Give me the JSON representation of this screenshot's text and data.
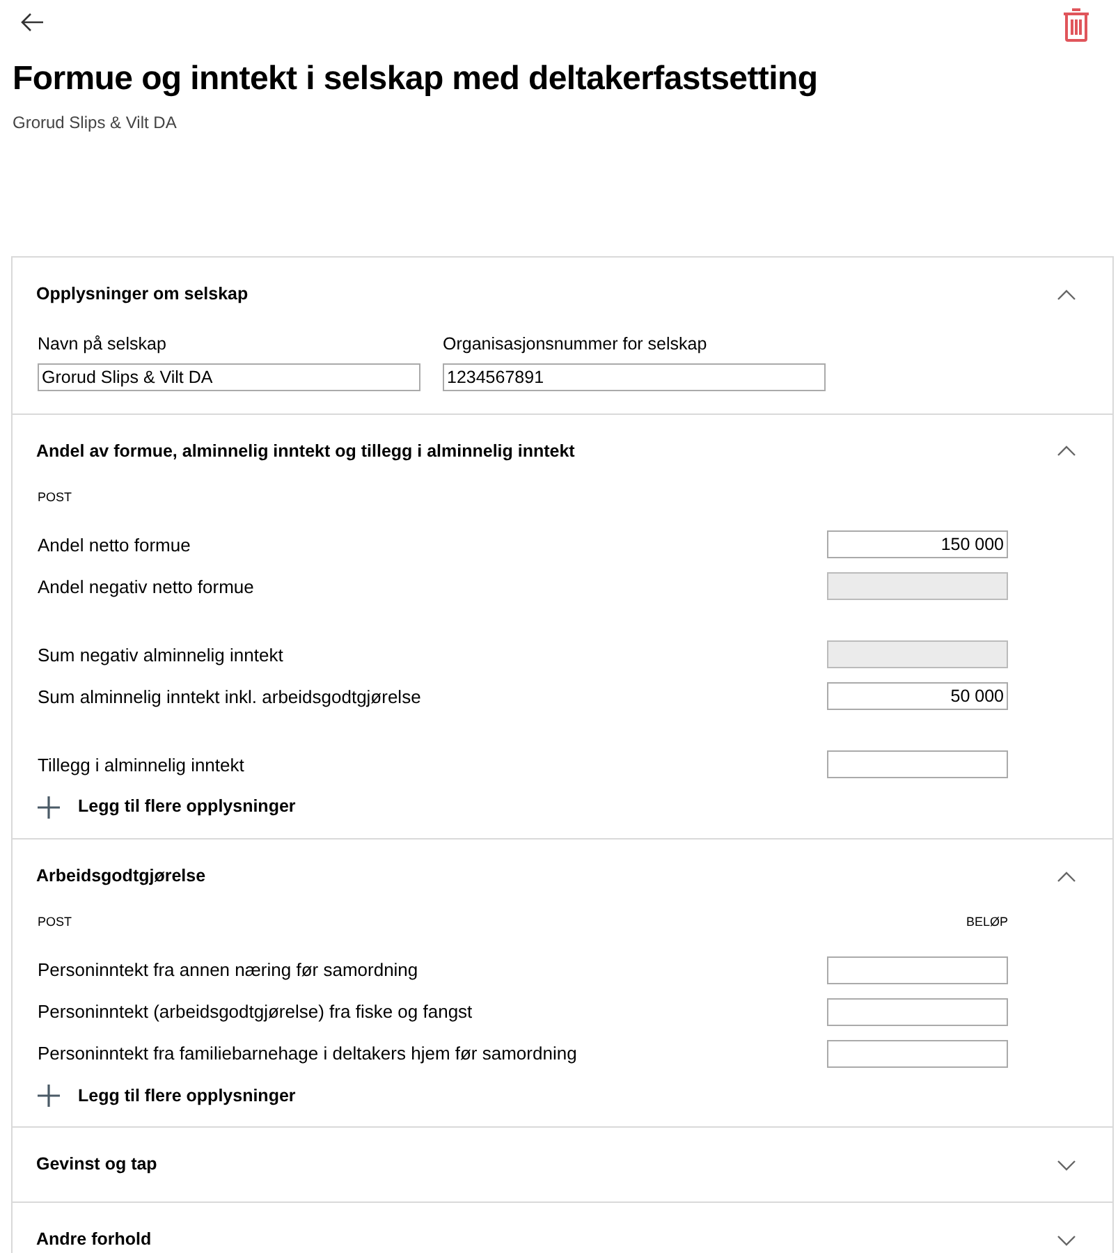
{
  "header": {
    "title": "Formue og inntekt i selskap med deltakerfastsetting",
    "subtitle": "Grorud Slips & Vilt DA"
  },
  "sections": [
    {
      "title": "Opplysninger om selskap",
      "expanded": true,
      "kind": "fields",
      "fields": [
        {
          "label": "Navn på selskap",
          "value": "Grorud Slips & Vilt DA"
        },
        {
          "label": "Organisasjonsnummer for selskap",
          "value": "1234567891"
        }
      ]
    },
    {
      "title": "Andel av formue, alminnelig inntekt og tillegg i alminnelig inntekt",
      "expanded": true,
      "kind": "items",
      "column_1": "POST",
      "groups": [
        [
          {
            "label": "Andel netto formue",
            "value": "150 000",
            "disabled": false
          },
          {
            "label": "Andel negativ netto formue",
            "disabled": true
          }
        ],
        [
          {
            "label": "Sum negativ alminnelig inntekt",
            "disabled": true
          },
          {
            "label": "Sum alminnelig inntekt inkl. arbeidsgodtgjørelse",
            "value": "50 000",
            "disabled": false
          }
        ],
        [
          {
            "label": "Tillegg i alminnelig inntekt",
            "disabled": false
          }
        ]
      ],
      "add_label": "Legg til flere opplysninger"
    },
    {
      "title": "Arbeidsgodtgjørelse",
      "expanded": true,
      "kind": "items",
      "column_1": "POST",
      "column_2": "BELØP",
      "groups": [
        [
          {
            "label": "Personinntekt fra annen næring før samordning",
            "disabled": false
          },
          {
            "label": "Personinntekt (arbeidsgodtgjørelse) fra fiske og fangst",
            "disabled": false
          },
          {
            "label": "Personinntekt fra familiebarnehage i deltakers hjem før samordning",
            "disabled": false
          }
        ]
      ],
      "add_label": "Legg til flere opplysninger"
    },
    {
      "title": "Gevinst og tap",
      "expanded": false
    },
    {
      "title": "Andre forhold",
      "expanded": false
    }
  ]
}
